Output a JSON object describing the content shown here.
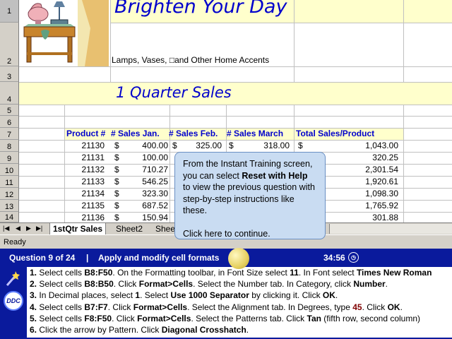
{
  "sheet": {
    "title": "Brighten Your Day",
    "subtitle": "Lamps, Vases, □and Other Home Accents",
    "quarter_title": "1 Quarter Sales",
    "row_numbers": [
      "1",
      "2",
      "3",
      "4",
      "5",
      "6",
      "7",
      "8",
      "9",
      "10",
      "11",
      "12",
      "13",
      "14"
    ],
    "headers": [
      "Product #",
      "# Sales Jan.",
      "# Sales Feb.",
      "# Sales March",
      "Total Sales/Product"
    ],
    "rows": [
      {
        "product": "21130",
        "jan": "400.00",
        "feb": "325.00",
        "mar": "318.00",
        "total": "1,043.00"
      },
      {
        "product": "21131",
        "jan": "100.00",
        "feb": "",
        "mar": "",
        "total": "320.25"
      },
      {
        "product": "21132",
        "jan": "710.27",
        "feb": "",
        "mar": "",
        "total": "2,301.54"
      },
      {
        "product": "21133",
        "jan": "546.25",
        "feb": "",
        "mar": "",
        "total": "1,920.61"
      },
      {
        "product": "21134",
        "jan": "323.30",
        "feb": "",
        "mar": "",
        "total": "1,098.30"
      },
      {
        "product": "21135",
        "jan": "687.52",
        "feb": "",
        "mar": "",
        "total": "1,765.92"
      },
      {
        "product": "21136",
        "jan": "150.94",
        "feb": "",
        "mar": "",
        "total": "301.88"
      }
    ],
    "currency": "$"
  },
  "tabs": {
    "items": [
      "1stQtr Sales",
      "Sheet2",
      "Shee"
    ]
  },
  "status": {
    "text": "Ready"
  },
  "question_bar": {
    "question": "Question 9 of 24",
    "separator": "|",
    "task": "Apply and modify cell formats",
    "timer": "34:56"
  },
  "callout": {
    "line1": "From the Instant Training screen, you can select ",
    "bold": "Reset with Help",
    "line2": " to view the previous question with step-by-step instructions like these.",
    "continue": "Click here to continue."
  },
  "logo": {
    "text": "DDC"
  },
  "steps": [
    {
      "n": "1.",
      "parts": [
        [
          "Select cells ",
          0
        ],
        [
          "B8:F50",
          1
        ],
        [
          ". On the Formatting toolbar, in Font Size select ",
          0
        ],
        [
          "11",
          1
        ],
        [
          ". In Font select ",
          0
        ],
        [
          "Times New Roman",
          1
        ]
      ]
    },
    {
      "n": "2.",
      "parts": [
        [
          "Select cells ",
          0
        ],
        [
          "B8:B50",
          1
        ],
        [
          ". Click ",
          0
        ],
        [
          "Format>Cells",
          1
        ],
        [
          ". Select the Number tab. In Category, click ",
          0
        ],
        [
          "Number",
          1
        ],
        [
          ".",
          0
        ]
      ]
    },
    {
      "n": "3.",
      "parts": [
        [
          "In Decimal places, select ",
          0
        ],
        [
          "1",
          1
        ],
        [
          ". Select ",
          0
        ],
        [
          "Use 1000 Separator",
          1
        ],
        [
          " by clicking it. Click ",
          0
        ],
        [
          "OK",
          1
        ],
        [
          ".",
          0
        ]
      ]
    },
    {
      "n": "4.",
      "parts": [
        [
          "Select cells ",
          0
        ],
        [
          "B7:F7",
          1
        ],
        [
          ". Click ",
          0
        ],
        [
          "Format>Cells",
          1
        ],
        [
          ". Select the Alignment tab. In Degrees, type ",
          0
        ],
        [
          "45",
          2
        ],
        [
          ". Click ",
          0
        ],
        [
          "OK",
          1
        ],
        [
          ".",
          0
        ]
      ]
    },
    {
      "n": "5.",
      "parts": [
        [
          "Select cells ",
          0
        ],
        [
          "F8:F50",
          1
        ],
        [
          ". Click ",
          0
        ],
        [
          "Format>Cells",
          1
        ],
        [
          ". Select the Patterns tab. Click ",
          0
        ],
        [
          "Tan",
          1
        ],
        [
          " (fifth row, second column)",
          0
        ]
      ]
    },
    {
      "n": "6.",
      "parts": [
        [
          "Click the arrow by Pattern. Click ",
          0
        ],
        [
          "Diagonal Crosshatch",
          1
        ],
        [
          ".",
          0
        ]
      ]
    }
  ],
  "colors": {
    "accent": "#0000cc",
    "bar": "#0a1a9c",
    "callout": "#c9dcf2",
    "highlight": "#800000"
  }
}
